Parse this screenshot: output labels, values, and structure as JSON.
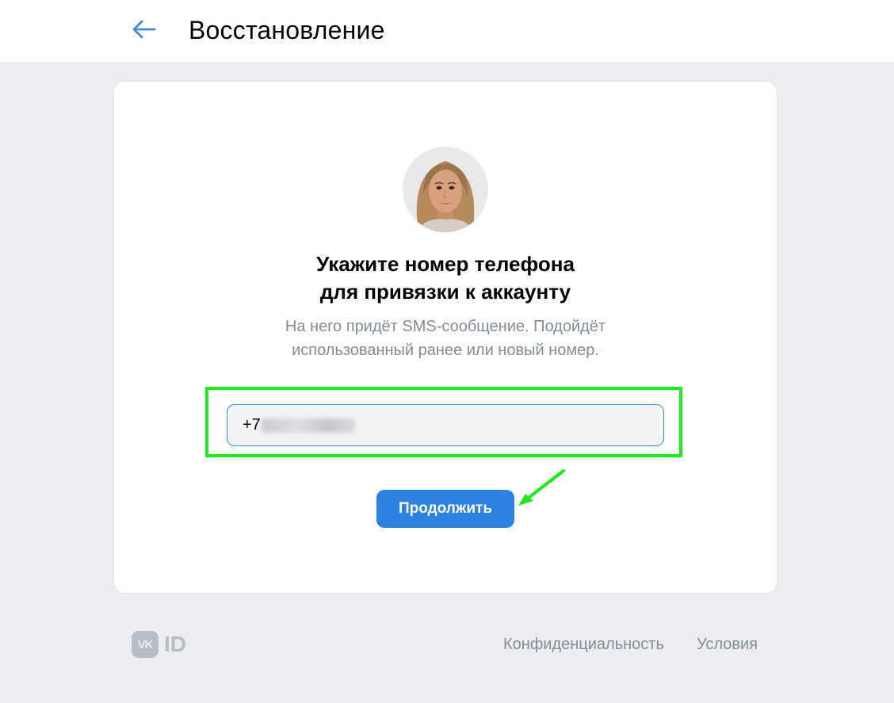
{
  "header": {
    "title": "Восстановление",
    "back_icon": "arrow-left-icon",
    "accent_color": "#3f8ae0"
  },
  "card": {
    "heading_line1": "Укажите номер телефона",
    "heading_line2": "для привязки к аккаунту",
    "description_line1": "На него придёт SMS-сообщение. Подойдёт",
    "description_line2": "использованный ранее или новый номер.",
    "phone": {
      "value_prefix": "+7",
      "value_obscured": true
    },
    "continue_label": "Продолжить",
    "button_color": "#2d81e0",
    "highlight_color": "#1ee81e"
  },
  "footer": {
    "logo_mark": "VK",
    "logo_text": "ID",
    "links": [
      "Конфиденциальность",
      "Условия"
    ]
  }
}
